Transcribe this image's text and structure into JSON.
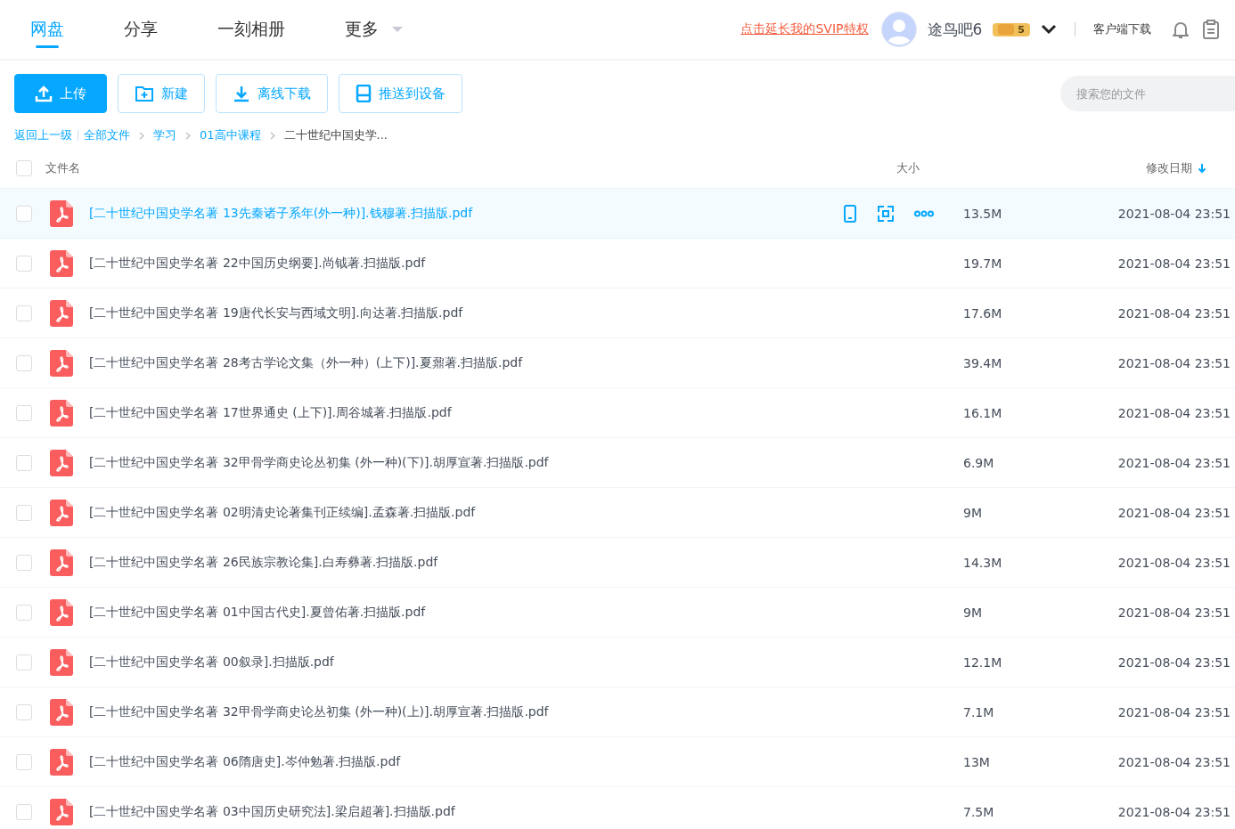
{
  "nav": {
    "tabs": [
      {
        "label": "网盘",
        "selected": true
      },
      {
        "label": "分享",
        "selected": false
      },
      {
        "label": "一刻相册",
        "selected": false
      },
      {
        "label": "更多",
        "selected": false,
        "dropdown": true
      }
    ]
  },
  "header": {
    "promo_link": "点击延长我的SVIP特权",
    "username": "途鸟吧6",
    "vip_badge": "5",
    "client_download": "客户端下载"
  },
  "toolbar": {
    "buttons": [
      {
        "label": "上传",
        "kind": "upload",
        "primary": true
      },
      {
        "label": "新建",
        "kind": "new-folder",
        "primary": false
      },
      {
        "label": "离线下载",
        "kind": "download",
        "primary": false
      },
      {
        "label": "推送到设备",
        "kind": "device",
        "primary": false
      }
    ],
    "search": {
      "placeholder": "搜索您的文件"
    }
  },
  "breadcrumb": {
    "back": "返回上一级",
    "items": [
      {
        "label": "全部文件",
        "current": false
      },
      {
        "label": "学习",
        "current": false
      },
      {
        "label": "01高中课程",
        "current": false
      },
      {
        "label": "二十世纪中国史学...",
        "current": true
      }
    ]
  },
  "table": {
    "select_all_checked": false,
    "columns": {
      "name": "文件名",
      "size": "大小",
      "date": "修改日期"
    },
    "rows": [
      {
        "name": "[二十世纪中国史学名著 13先秦诸子系年(外一种)].钱穆著.扫描版.pdf",
        "size": "13.5M",
        "date": "2021-08-04 23:51",
        "selected": true
      },
      {
        "name": "[二十世纪中国史学名著 22中国历史纲要].尚钺著.扫描版.pdf",
        "size": "19.7M",
        "date": "2021-08-04 23:51",
        "selected": false
      },
      {
        "name": "[二十世纪中国史学名著 19唐代长安与西域文明].向达著.扫描版.pdf",
        "size": "17.6M",
        "date": "2021-08-04 23:51",
        "selected": false
      },
      {
        "name": "[二十世纪中国史学名著 28考古学论文集（外一种）(上下)].夏鼐著.扫描版.pdf",
        "size": "39.4M",
        "date": "2021-08-04 23:51",
        "selected": false
      },
      {
        "name": "[二十世纪中国史学名著 17世界通史 (上下)].周谷城著.扫描版.pdf",
        "size": "16.1M",
        "date": "2021-08-04 23:51",
        "selected": false
      },
      {
        "name": "[二十世纪中国史学名著 32甲骨学商史论丛初集 (外一种)(下)].胡厚宣著.扫描版.pdf",
        "size": "6.9M",
        "date": "2021-08-04 23:51",
        "selected": false
      },
      {
        "name": "[二十世纪中国史学名著 02明清史论著集刊正续编].孟森著.扫描版.pdf",
        "size": "9M",
        "date": "2021-08-04 23:51",
        "selected": false
      },
      {
        "name": "[二十世纪中国史学名著 26民族宗教论集].白寿彝著.扫描版.pdf",
        "size": "14.3M",
        "date": "2021-08-04 23:51",
        "selected": false
      },
      {
        "name": "[二十世纪中国史学名著 01中国古代史].夏曾佑著.扫描版.pdf",
        "size": "9M",
        "date": "2021-08-04 23:51",
        "selected": false
      },
      {
        "name": "[二十世纪中国史学名著 00叙录].扫描版.pdf",
        "size": "12.1M",
        "date": "2021-08-04 23:51",
        "selected": false
      },
      {
        "name": "[二十世纪中国史学名著 32甲骨学商史论丛初集 (外一种)(上)].胡厚宣著.扫描版.pdf",
        "size": "7.1M",
        "date": "2021-08-04 23:51",
        "selected": false
      },
      {
        "name": "[二十世纪中国史学名著 06隋唐史].岑仲勉著.扫描版.pdf",
        "size": "13M",
        "date": "2021-08-04 23:51",
        "selected": false
      },
      {
        "name": "[二十世纪中国史学名著 03中国历史研究法].梁启超著].扫描版.pdf",
        "size": "7.5M",
        "date": "2021-08-04 23:51",
        "selected": false
      }
    ]
  }
}
